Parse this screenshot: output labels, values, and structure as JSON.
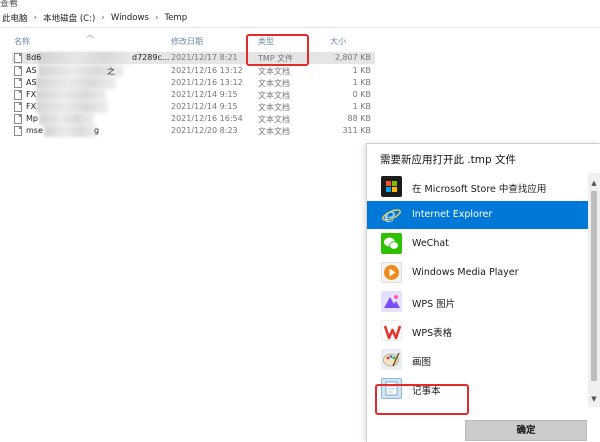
{
  "window": {
    "menu_fragment": "查看"
  },
  "breadcrumb": [
    "此电脑",
    "本地磁盘 (C:)",
    "Windows",
    "Temp"
  ],
  "breadcrumb_separator": "›",
  "columns": {
    "name": "名称",
    "date": "修改日期",
    "type": "类型",
    "size": "大小"
  },
  "files": [
    {
      "name": "8d6",
      "name_suffix": "d7289c...",
      "date": "2021/12/17 8:21",
      "type": "TMP 文件",
      "size": "2,807 KB",
      "selected": true
    },
    {
      "name": "AS",
      "name_suffix": "之",
      "date": "2021/12/16 13:12",
      "type": "文本文档",
      "size": "1 KB",
      "selected": false
    },
    {
      "name": "AS",
      "name_suffix": "",
      "date": "2021/12/16 13:12",
      "type": "文本文档",
      "size": "1 KB",
      "selected": false
    },
    {
      "name": "FX",
      "name_suffix": "",
      "date": "2021/12/14 9:15",
      "type": "文本文档",
      "size": "0 KB",
      "selected": false
    },
    {
      "name": "FX",
      "name_suffix": "",
      "date": "2021/12/14 9:15",
      "type": "文本文档",
      "size": "1 KB",
      "selected": false
    },
    {
      "name": "Mp",
      "name_suffix": "",
      "date": "2021/12/16 16:54",
      "type": "文本文档",
      "size": "88 KB",
      "selected": false
    },
    {
      "name": "mse",
      "name_suffix": "g",
      "date": "2021/12/20 8:23",
      "type": "文本文档",
      "size": "311 KB",
      "selected": false
    }
  ],
  "dialog": {
    "title": "需要新应用打开此 .tmp 文件",
    "apps": [
      {
        "label": "在 Microsoft Store 中查找应用",
        "icon": "store-icon",
        "selected": false
      },
      {
        "label": "Internet Explorer",
        "icon": "internet-explorer-icon",
        "selected": true
      },
      {
        "label": "WeChat",
        "icon": "wechat-icon",
        "selected": false
      },
      {
        "label": "Windows Media Player",
        "icon": "media-player-icon",
        "selected": false
      },
      {
        "label": "WPS 图片",
        "icon": "wps-picture-icon",
        "selected": false
      },
      {
        "label": "WPS表格",
        "icon": "wps-spreadsheet-icon",
        "selected": false
      },
      {
        "label": "画图",
        "icon": "paint-icon",
        "selected": false
      },
      {
        "label": "记事本",
        "icon": "notepad-icon",
        "selected": false
      }
    ],
    "ok_label": "确定"
  },
  "colors": {
    "selection_blue": "#0078d7",
    "annotation_red": "#e52a2a",
    "row_selected_gray": "#e5e5e5"
  }
}
